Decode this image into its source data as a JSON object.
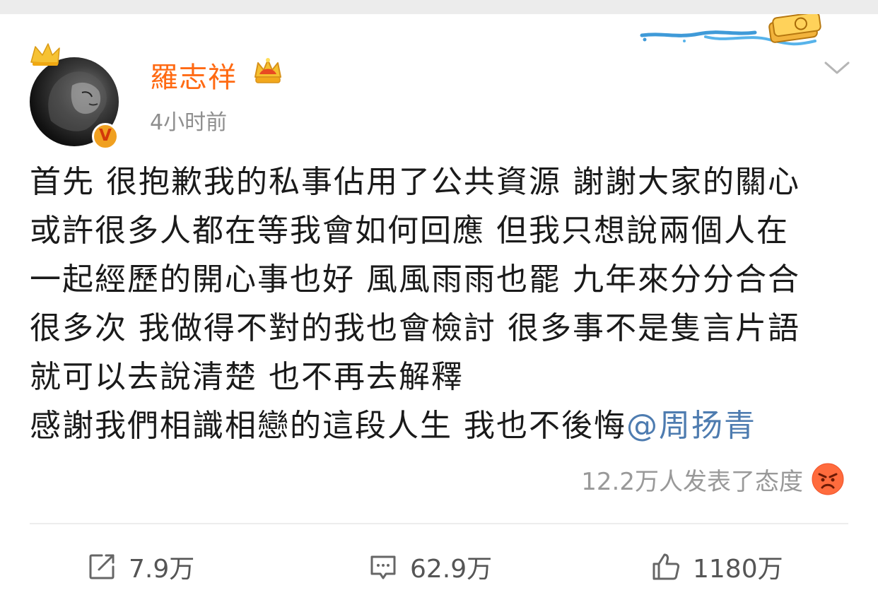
{
  "post": {
    "author": {
      "name": "羅志祥",
      "verified_badge": "V",
      "avatar_icon": "lion-avatar",
      "member_badge_icon": "crown-icon"
    },
    "timestamp": "4小时前",
    "content_lines": [
      "首先 很抱歉我的私事佔用了公共資源 謝謝大家的關心",
      "或許很多人都在等我會如何回應 但我只想說兩個人在",
      "一起經歷的開心事也好 風風雨雨也罷 九年來分分合合",
      "很多次 我做得不對的我也會檢討 很多事不是隻言片語",
      "就可以去說清楚 也不再去解釋",
      "感謝我們相識相戀的這段人生 我也不後悔"
    ],
    "mention": "@周扬青",
    "reactions_text": "12.2万人发表了态度",
    "reaction_icon": "angry-face-icon"
  },
  "actions": {
    "repost_count": "7.9万",
    "comment_count": "62.9万",
    "like_count": "1180万"
  },
  "colors": {
    "username": "#ff6a13",
    "mention": "#4e7cb0",
    "timestamp": "#8e8e8e",
    "text": "#1a1a1a"
  }
}
